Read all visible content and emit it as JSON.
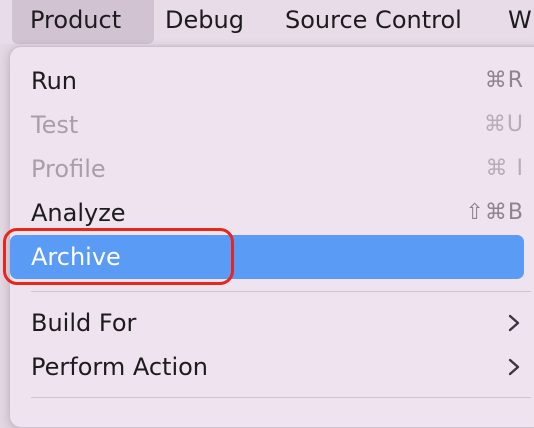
{
  "menubar": {
    "items": [
      {
        "label": "Product"
      },
      {
        "label": "Debug"
      },
      {
        "label": "Source Control"
      },
      {
        "label": "W"
      }
    ]
  },
  "menu": {
    "items": [
      {
        "label": "Run",
        "shortcut": "⌘R",
        "enabled": true
      },
      {
        "label": "Test",
        "shortcut": "⌘U",
        "enabled": false
      },
      {
        "label": "Profile",
        "shortcut": "⌘ I",
        "enabled": false
      },
      {
        "label": "Analyze",
        "shortcut": "⇧⌘B",
        "enabled": true
      },
      {
        "label": "Archive",
        "shortcut": "",
        "enabled": true,
        "highlighted": true
      },
      {
        "label": "Build For",
        "submenu": true,
        "enabled": true
      },
      {
        "label": "Perform Action",
        "submenu": true,
        "enabled": true
      }
    ]
  },
  "colors": {
    "selection": "#5a9bf5",
    "annotation_ring": "#e8261b"
  }
}
